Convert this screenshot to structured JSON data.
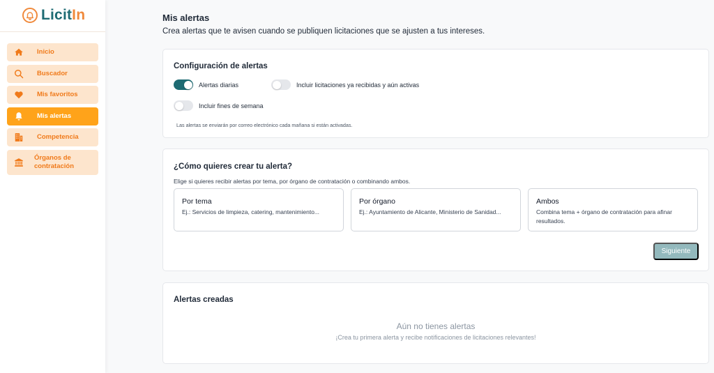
{
  "brand": {
    "name_main": "Licit",
    "name_accent": "In"
  },
  "sidebar": {
    "items": [
      {
        "label": "Inicio",
        "icon": "home-icon",
        "active": false
      },
      {
        "label": "Buscador",
        "icon": "search-icon",
        "active": false
      },
      {
        "label": "Mis favoritos",
        "icon": "heart-icon",
        "active": false
      },
      {
        "label": "Mis alertas",
        "icon": "bell-icon",
        "active": true
      },
      {
        "label": "Competencia",
        "icon": "building-icon",
        "active": false
      },
      {
        "label": "Órganos de contratación",
        "icon": "bank-icon",
        "active": false
      }
    ]
  },
  "page": {
    "title": "Mis alertas",
    "subtitle": "Crea alertas que te avisen cuando se publiquen licitaciones que se ajusten a tus intereses."
  },
  "config": {
    "title": "Configuración de alertas",
    "toggles": [
      {
        "label": "Alertas diarias",
        "on": true
      },
      {
        "label": "Incluir licitaciones ya recibidas y aún activas",
        "on": false
      },
      {
        "label": "Incluir fines de semana",
        "on": false
      }
    ],
    "note": "Las alertas se enviarán por correo electrónico cada mañana si están activadas."
  },
  "create": {
    "title": "¿Cómo quieres crear tu alerta?",
    "description": "Elige si quieres recibir alertas por tema, por órgano de contratación o combinando ambos.",
    "options": [
      {
        "title": "Por tema",
        "description": "Ej.: Servicios de limpieza, catering, mantenimiento..."
      },
      {
        "title": "Por órgano",
        "description": "Ej.: Ayuntamiento de Alicante, Ministerio de Sanidad..."
      },
      {
        "title": "Ambos",
        "description": "Combina tema + órgano de contratación para afinar resultados."
      }
    ],
    "next_label": "Siguiente"
  },
  "created": {
    "title": "Alertas creadas",
    "empty_title": "Aún no tienes alertas",
    "empty_subtitle": "¡Crea tu primera alerta y recibe notificaciones de licitaciones relevantes!"
  },
  "colors": {
    "brand_teal": "#1e6b73",
    "brand_orange": "#f08a3c",
    "nav_bg": "#fde5cd",
    "nav_active": "#ffa31a",
    "button_disabled": "#93b9bd"
  }
}
